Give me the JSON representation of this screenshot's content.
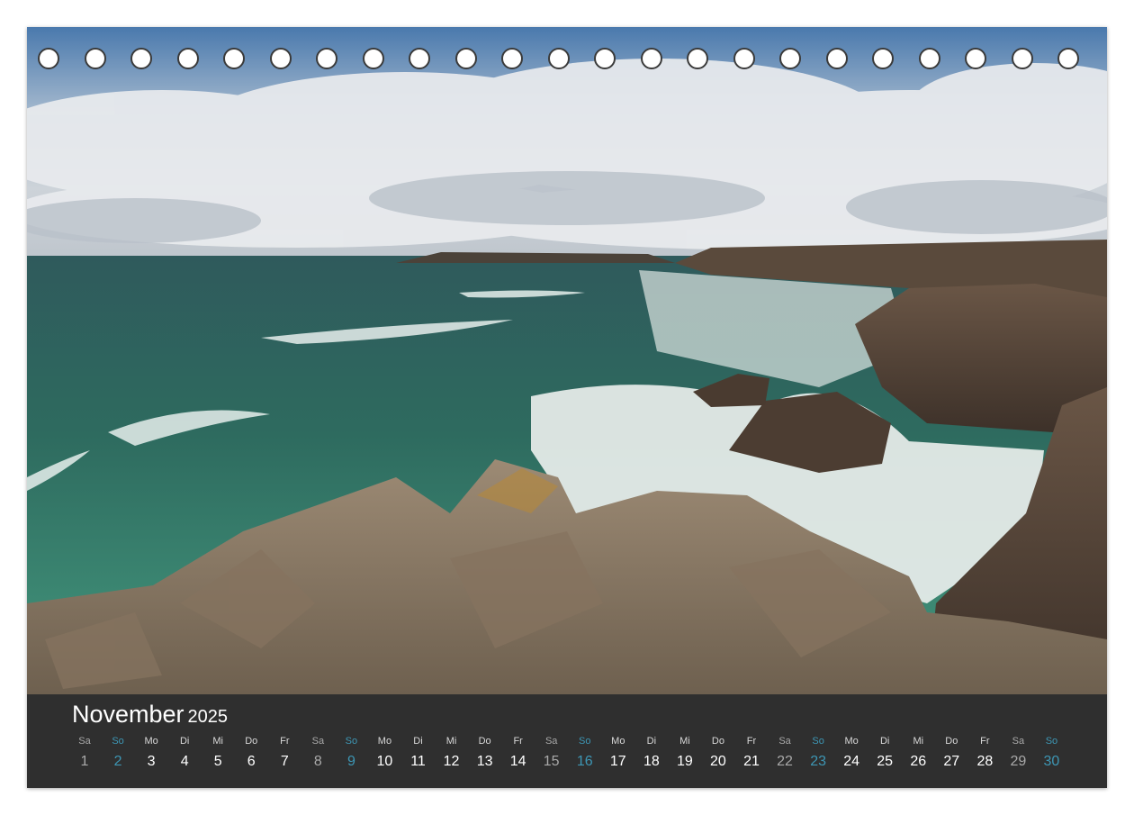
{
  "calendar": {
    "month": "November",
    "year": "2025",
    "days": [
      {
        "name": "Sa",
        "num": "1",
        "kind": "sat"
      },
      {
        "name": "So",
        "num": "2",
        "kind": "sun"
      },
      {
        "name": "Mo",
        "num": "3",
        "kind": "day"
      },
      {
        "name": "Di",
        "num": "4",
        "kind": "day"
      },
      {
        "name": "Mi",
        "num": "5",
        "kind": "day"
      },
      {
        "name": "Do",
        "num": "6",
        "kind": "day"
      },
      {
        "name": "Fr",
        "num": "7",
        "kind": "day"
      },
      {
        "name": "Sa",
        "num": "8",
        "kind": "sat"
      },
      {
        "name": "So",
        "num": "9",
        "kind": "sun"
      },
      {
        "name": "Mo",
        "num": "10",
        "kind": "day"
      },
      {
        "name": "Di",
        "num": "11",
        "kind": "day"
      },
      {
        "name": "Mi",
        "num": "12",
        "kind": "day"
      },
      {
        "name": "Do",
        "num": "13",
        "kind": "day"
      },
      {
        "name": "Fr",
        "num": "14",
        "kind": "day"
      },
      {
        "name": "Sa",
        "num": "15",
        "kind": "sat"
      },
      {
        "name": "So",
        "num": "16",
        "kind": "sun"
      },
      {
        "name": "Mo",
        "num": "17",
        "kind": "day"
      },
      {
        "name": "Di",
        "num": "18",
        "kind": "day"
      },
      {
        "name": "Mi",
        "num": "19",
        "kind": "day"
      },
      {
        "name": "Do",
        "num": "20",
        "kind": "day"
      },
      {
        "name": "Fr",
        "num": "21",
        "kind": "day"
      },
      {
        "name": "Sa",
        "num": "22",
        "kind": "sat"
      },
      {
        "name": "So",
        "num": "23",
        "kind": "sun"
      },
      {
        "name": "Mo",
        "num": "24",
        "kind": "day"
      },
      {
        "name": "Di",
        "num": "25",
        "kind": "day"
      },
      {
        "name": "Mi",
        "num": "26",
        "kind": "day"
      },
      {
        "name": "Do",
        "num": "27",
        "kind": "day"
      },
      {
        "name": "Fr",
        "num": "28",
        "kind": "day"
      },
      {
        "name": "Sa",
        "num": "29",
        "kind": "sat"
      },
      {
        "name": "So",
        "num": "30",
        "kind": "sun"
      }
    ]
  },
  "binding": {
    "hole_count": 23
  },
  "colors": {
    "strip_background": "#2f2f2f",
    "weekday_text": "#ffffff",
    "saturday_text": "#a9a9a9",
    "sunday_text": "#3d96b4"
  }
}
